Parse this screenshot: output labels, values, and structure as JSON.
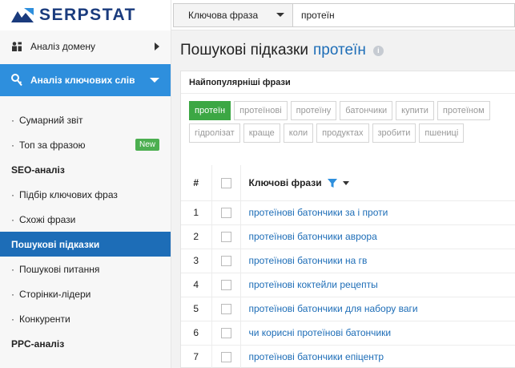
{
  "app": {
    "logo_text": "SERPSTAT",
    "brand_color": "#1a3b7d",
    "accent_color": "#2e8fdd"
  },
  "topbar": {
    "search_type": "Ключова фраза",
    "search_value": "протеїн"
  },
  "sidebar": {
    "domain_analysis": "Аналіз домену",
    "keyword_analysis": "Аналіз ключових слів",
    "items": [
      {
        "label": "Сумарний звіт",
        "dot": "·",
        "type": "item"
      },
      {
        "label": "Топ за фразою",
        "dot": "·",
        "type": "item",
        "badge": "New"
      },
      {
        "label": "SEO-аналіз",
        "type": "section"
      },
      {
        "label": "Підбір ключових фраз",
        "dot": "·",
        "type": "item"
      },
      {
        "label": "Схожі фрази",
        "dot": "·",
        "type": "item"
      },
      {
        "label": "Пошукові підказки",
        "type": "active"
      },
      {
        "label": "Пошукові питання",
        "dot": "·",
        "type": "item"
      },
      {
        "label": "Сторінки-лідери",
        "dot": "·",
        "type": "item"
      },
      {
        "label": "Конкуренти",
        "dot": "·",
        "type": "item"
      },
      {
        "label": "PPC-аналіз",
        "type": "section"
      }
    ]
  },
  "main": {
    "title": "Пошукові підказки",
    "title_keyword": "протеїн",
    "info_icon_glyph": "i",
    "panel_title": "Найпопулярніші фрази",
    "chips": [
      {
        "label": "протеїн",
        "active": true
      },
      {
        "label": "протеїнові",
        "active": false
      },
      {
        "label": "протеїну",
        "active": false
      },
      {
        "label": "батончики",
        "active": false
      },
      {
        "label": "купити",
        "active": false
      },
      {
        "label": "протеїном",
        "active": false
      },
      {
        "label": "гідролізат",
        "active": false
      },
      {
        "label": "краще",
        "active": false
      },
      {
        "label": "коли",
        "active": false
      },
      {
        "label": "продуктах",
        "active": false
      },
      {
        "label": "зробити",
        "active": false
      },
      {
        "label": "пшениці",
        "active": false
      }
    ],
    "table": {
      "col_num": "#",
      "col_phrase": "Ключові фрази",
      "rows": [
        {
          "num": "1",
          "phrase": "протеїнові батончики за і проти"
        },
        {
          "num": "2",
          "phrase": "протеїнові батончики аврора"
        },
        {
          "num": "3",
          "phrase": "протеїнові батончики на гв"
        },
        {
          "num": "4",
          "phrase": "протеїнові коктейли рецепты"
        },
        {
          "num": "5",
          "phrase": "протеїнові батончики для набору ваги"
        },
        {
          "num": "6",
          "phrase": "чи корисні протеїнові батончики"
        },
        {
          "num": "7",
          "phrase": "протеїнові батончики епіцентр"
        }
      ]
    }
  }
}
